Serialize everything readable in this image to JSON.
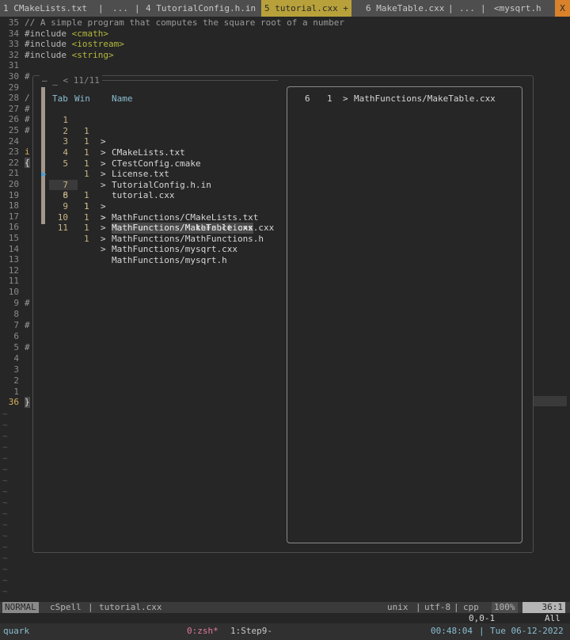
{
  "tabs": [
    {
      "label": "1 CMakeLists.txt"
    },
    {
      "label": "|"
    },
    {
      "label": "..."
    },
    {
      "label": "|"
    },
    {
      "label": "4 TutorialConfig.h.in"
    },
    {
      "label": "5 tutorial.cxx +"
    },
    {
      "label": "6 MakeTable.cxx"
    },
    {
      "label": "|"
    },
    {
      "label": "..."
    },
    {
      "label": "|"
    },
    {
      "label": "<mysqrt.h"
    },
    {
      "label": "X"
    }
  ],
  "editor": {
    "lines": [
      {
        "num": "35",
        "text": "// A simple program that computes the square root of a number"
      },
      {
        "num": "34",
        "text": "#include <cmath>"
      },
      {
        "num": "33",
        "text": "#include <iostream>"
      },
      {
        "num": "32",
        "text": "#include <string>"
      },
      {
        "num": "31",
        "text": ""
      },
      {
        "num": "30",
        "text": "#"
      },
      {
        "num": "29",
        "text": ""
      },
      {
        "num": "28",
        "text": "/"
      },
      {
        "num": "27",
        "text": "#"
      },
      {
        "num": "26",
        "text": "#"
      },
      {
        "num": "25",
        "text": "#"
      },
      {
        "num": "24",
        "text": ""
      },
      {
        "num": "23",
        "text": "i"
      },
      {
        "num": "22",
        "text": "{"
      },
      {
        "num": "21",
        "text": ""
      },
      {
        "num": "20",
        "text": ""
      },
      {
        "num": "19",
        "text": ""
      },
      {
        "num": "18",
        "text": ""
      },
      {
        "num": "17",
        "text": ""
      },
      {
        "num": "16",
        "text": ""
      },
      {
        "num": "15",
        "text": ""
      },
      {
        "num": "14",
        "text": ""
      },
      {
        "num": "13",
        "text": ""
      },
      {
        "num": "12",
        "text": ""
      },
      {
        "num": "11",
        "text": ""
      },
      {
        "num": "10",
        "text": ""
      },
      {
        "num": "9",
        "text": "#"
      },
      {
        "num": "8",
        "text": ""
      },
      {
        "num": "7",
        "text": "#"
      },
      {
        "num": "6",
        "text": ""
      },
      {
        "num": "5",
        "text": "#"
      },
      {
        "num": "4",
        "text": ""
      },
      {
        "num": "3",
        "text": ""
      },
      {
        "num": "2",
        "text": ""
      },
      {
        "num": "1",
        "text": ""
      },
      {
        "num": "36",
        "text": "}"
      }
    ]
  },
  "popup": {
    "header_counter": "< 11/11",
    "col_tab": "Tab",
    "col_win": "Win",
    "col_name": "Name",
    "rows": [
      {
        "tab": "1",
        "win": "1",
        "name": "CMakeLists.txt"
      },
      {
        "tab": "2",
        "win": "1",
        "name": "CTestConfig.cmake"
      },
      {
        "tab": "3",
        "win": "1",
        "name": "License.txt"
      },
      {
        "tab": "4",
        "win": "1",
        "name": "TutorialConfig.h.in"
      },
      {
        "tab": "5",
        "win": "1",
        "name": "tutorial.cxx"
      },
      {
        "tab": "6",
        "win": "1",
        "name": "MathFunctions/MakeTable.cxx"
      },
      {
        "tab": "7",
        "win": "1",
        "name": "MathFunctions/CMakeLists.txt"
      },
      {
        "tab": "8",
        "win": "1",
        "name": "MathFunctions/MathFunctions.cxx"
      },
      {
        "tab": "9",
        "win": "1",
        "name": "MathFunctions/MathFunctions.h"
      },
      {
        "tab": "10",
        "win": "1",
        "name": "MathFunctions/mysqrt.cxx"
      },
      {
        "tab": "11",
        "win": "1",
        "name": "MathFunctions/mysqrt.h"
      }
    ],
    "preview": {
      "tab": "6",
      "win": "1",
      "name": "MathFunctions/MakeTable.cxx"
    }
  },
  "statusline": {
    "mode": "NORMAL",
    "spell": "cSpell",
    "file": "tutorial.cxx",
    "fileformat": "unix",
    "encoding": "utf-8",
    "filetype": "cpp",
    "percent": "100%",
    "position": "36:1"
  },
  "cmdline": {
    "ruler": "0,0-1",
    "scroll": "All"
  },
  "tmux": {
    "session": "quark",
    "window0": "0:zsh*",
    "window1": "1:Step9-",
    "clock": "00:48:04",
    "date": "Tue 06-12-2022"
  },
  "colors": {
    "active_tab": "#b8a13a",
    "close_button": "#d9822b",
    "accent_blue": "#8abdd0",
    "header_yellow": "#b5b83d"
  }
}
